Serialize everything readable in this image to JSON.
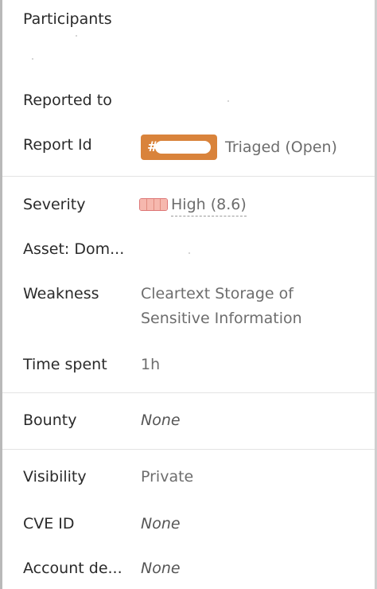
{
  "details": {
    "participants": {
      "label": "Participants"
    },
    "reported_to": {
      "label": "Reported to"
    },
    "report_id": {
      "label": "Report Id",
      "badge_prefix": "#",
      "status": "Triaged (Open)",
      "badge_color": "#d9833b"
    },
    "severity": {
      "label": "Severity",
      "value": "High (8.6)",
      "level_fraction": 0.86,
      "color": "#f6b8ae"
    },
    "asset": {
      "label": "Asset: Dom..."
    },
    "weakness": {
      "label": "Weakness",
      "value": "Cleartext Storage of Sensitive Information"
    },
    "time_spent": {
      "label": "Time spent",
      "value": "1h"
    },
    "bounty": {
      "label": "Bounty",
      "value": "None"
    },
    "visibility": {
      "label": "Visibility",
      "value": "Private"
    },
    "cve_id": {
      "label": "CVE ID",
      "value": "None"
    },
    "account_details": {
      "label": "Account de...",
      "value": "None"
    }
  }
}
